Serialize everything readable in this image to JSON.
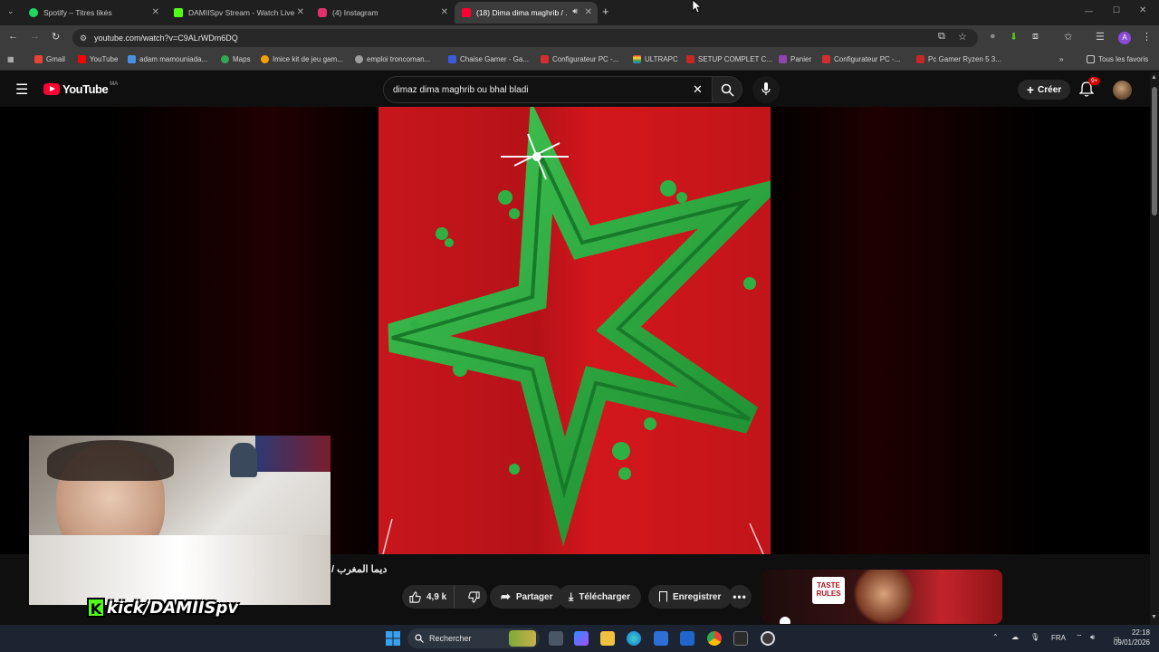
{
  "browser": {
    "tabs": [
      {
        "label": "Spotify – Titres likés",
        "favicon": "spotify-icon",
        "color": "#1ed760"
      },
      {
        "label": "DAMIISpv Stream - Watch Live",
        "favicon": "kick-icon",
        "color": "#53fc18"
      },
      {
        "label": "(4) Instagram",
        "favicon": "instagram-icon",
        "color": "#e1306c"
      },
      {
        "label": "(18) Dima dima maghrib / ...",
        "favicon": "youtube-icon",
        "color": "#ff0033",
        "active": true
      }
    ],
    "url": "youtube.com/watch?v=C9ALrWDm6DQ",
    "bookmarks": [
      {
        "label": "Gmail",
        "color": "#ea4335"
      },
      {
        "label": "YouTube",
        "color": "#ff0000"
      },
      {
        "label": "adam mamouniada...",
        "color": "#4a90e2"
      },
      {
        "label": "Maps",
        "color": "#34a853"
      },
      {
        "label": "Imice kit de jeu gam...",
        "color": "#f4a100"
      },
      {
        "label": "emploi troncoman...",
        "color": "#9e9e9e"
      },
      {
        "label": "Chaise Gamer - Ga...",
        "color": "#3b5bdb"
      },
      {
        "label": "Configurateur PC -...",
        "color": "#d32f2f"
      },
      {
        "label": "ULTRAPC",
        "color": "#7cb342"
      },
      {
        "label": "SETUP COMPLET C...",
        "color": "#c62828"
      },
      {
        "label": "Panier",
        "color": "#8e44ad"
      },
      {
        "label": "Configurateur PC -...",
        "color": "#d32f2f"
      },
      {
        "label": "Pc Gamer Ryzen 5 3...",
        "color": "#c62828"
      }
    ],
    "all_favorites": "Tous les favoris"
  },
  "youtube": {
    "logo_text": "YouTube",
    "country_code": "MA",
    "search_query": "dimaz dima maghrib ou bhal bladi",
    "create_label": "Créer",
    "notification_count": "9+",
    "video_title": "ديما المغرب /",
    "likes": "4,9 k",
    "share_label": "Partager",
    "download_label": "Télécharger",
    "save_label": "Enregistrer",
    "ad_brand": "TASTE RULES",
    "kick_handle": "kick/DAMIISpv"
  },
  "taskbar": {
    "search_label": "Rechercher",
    "language": "FRA",
    "time": "22:18",
    "date": "09/01/2026"
  }
}
